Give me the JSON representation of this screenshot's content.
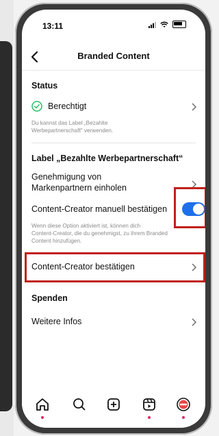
{
  "status_bar": {
    "time": "13:11"
  },
  "nav": {
    "title": "Branded Content"
  },
  "status_section": {
    "heading": "Status",
    "eligible_label": "Berechtigt",
    "eligible_desc_line1": "Du kannst das Label „Bezahlte",
    "eligible_desc_line2": "Werbepartnerschaft\" verwenden."
  },
  "label_section": {
    "heading": "Label „Bezahlte Werbepartnerschaft“",
    "approval_line1": "Genehmigung von",
    "approval_line2": "Markenpartnern einholen",
    "manual_label": "Content-Creator manuell bestätigen",
    "manual_desc_line1": "Wenn diese Option aktiviert ist, können dich",
    "manual_desc_line2": "Content-Creator, die du genehmigst, zu ihrem Branded",
    "manual_desc_line3": "Content hinzufügen.",
    "confirm_creators_label": "Content-Creator bestätigen"
  },
  "donations_section": {
    "heading": "Spenden",
    "more_info_label": "Weitere Infos"
  },
  "colors": {
    "accent": "#1f6feb",
    "highlight": "#c0201a",
    "check": "#2fbf6b"
  },
  "icons": {
    "back": "chevron-left-icon",
    "check": "check-circle-icon",
    "chevron": "chevron-right-icon",
    "home": "home-icon",
    "search": "search-icon",
    "create": "plus-square-icon",
    "reels": "reels-icon",
    "profile": "profile-avatar-icon"
  },
  "toggle_manual": {
    "on": true
  }
}
